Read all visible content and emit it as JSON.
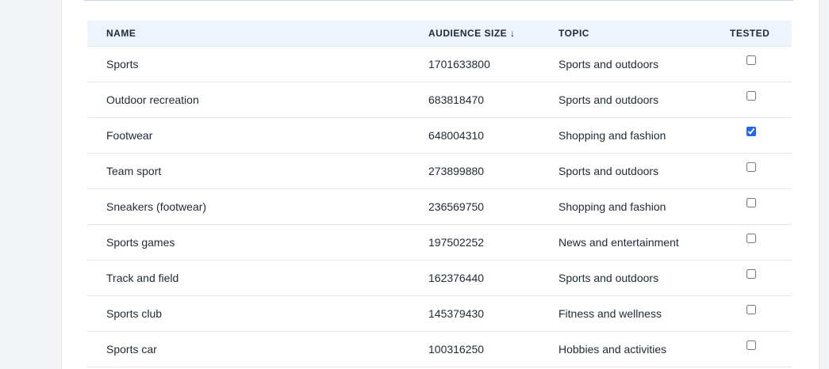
{
  "table": {
    "headers": {
      "name": "NAME",
      "audience_size": "AUDIENCE SIZE ↓",
      "topic": "TOPIC",
      "tested": "TESTED"
    },
    "rows": [
      {
        "name": "Sports",
        "audience_size": "1701633800",
        "topic": "Sports and outdoors",
        "tested": false
      },
      {
        "name": "Outdoor recreation",
        "audience_size": "683818470",
        "topic": "Sports and outdoors",
        "tested": false
      },
      {
        "name": "Footwear",
        "audience_size": "648004310",
        "topic": "Shopping and fashion",
        "tested": true
      },
      {
        "name": "Team sport",
        "audience_size": "273899880",
        "topic": "Sports and outdoors",
        "tested": false
      },
      {
        "name": "Sneakers (footwear)",
        "audience_size": "236569750",
        "topic": "Shopping and fashion",
        "tested": false
      },
      {
        "name": "Sports games",
        "audience_size": "197502252",
        "topic": "News and entertainment",
        "tested": false
      },
      {
        "name": "Track and field",
        "audience_size": "162376440",
        "topic": "Sports and outdoors",
        "tested": false
      },
      {
        "name": "Sports club",
        "audience_size": "145379430",
        "topic": "Fitness and wellness",
        "tested": false
      },
      {
        "name": "Sports car",
        "audience_size": "100316250",
        "topic": "Hobbies and activities",
        "tested": false
      }
    ]
  },
  "colors": {
    "header_bg": "#eef4fe",
    "accent": "#2563eb",
    "text": "#1f2937",
    "border": "#e5e7eb"
  }
}
